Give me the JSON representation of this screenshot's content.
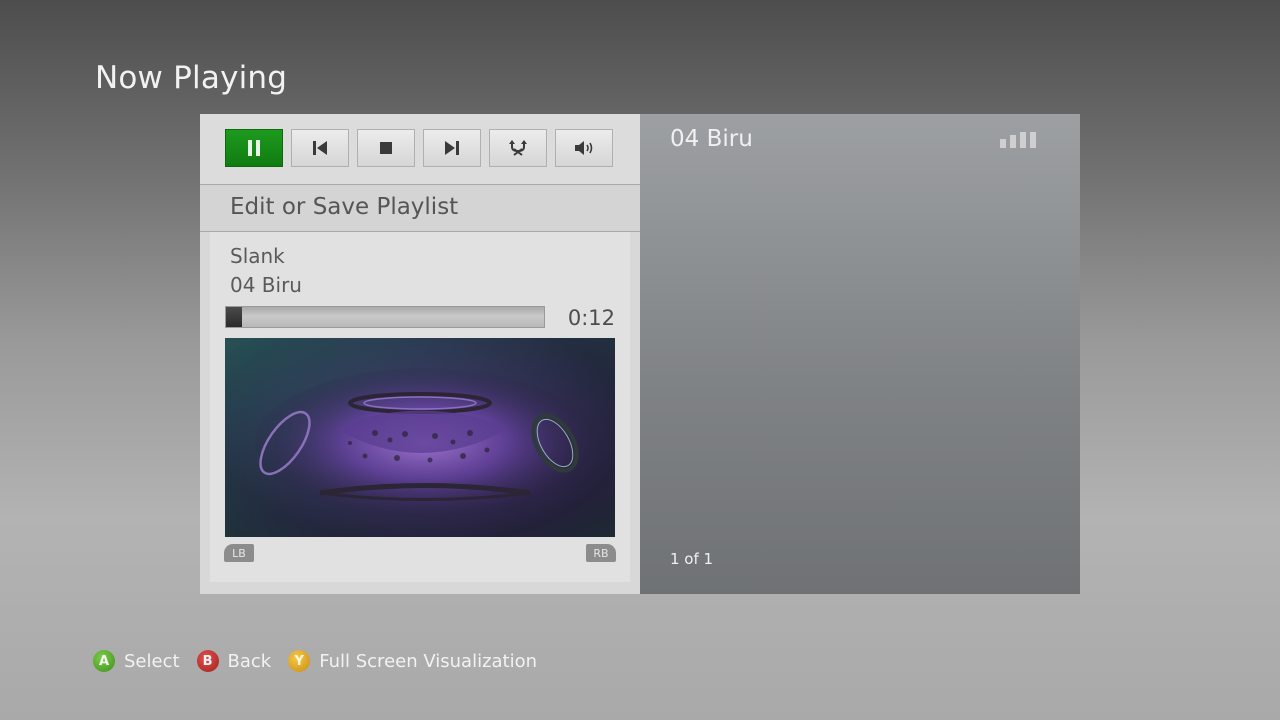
{
  "page_title": "Now Playing",
  "controls": [
    {
      "name": "pause",
      "icon": "pause-icon",
      "active": true
    },
    {
      "name": "previous",
      "icon": "previous-track-icon",
      "active": false
    },
    {
      "name": "stop",
      "icon": "stop-icon",
      "active": false
    },
    {
      "name": "next",
      "icon": "next-track-icon",
      "active": false
    },
    {
      "name": "shuffle-repeat",
      "icon": "shuffle-repeat-icon",
      "active": false
    },
    {
      "name": "volume",
      "icon": "volume-icon",
      "active": false
    }
  ],
  "playlist": {
    "label": "Edit or Save Playlist"
  },
  "now_playing": {
    "artist": "Slank",
    "track": "04 Biru",
    "elapsed": "0:12",
    "progress_fraction": 0.05
  },
  "bumpers": {
    "left": "LB",
    "right": "RB"
  },
  "queue": {
    "title": "04 Biru",
    "page": "1 of 1",
    "indicator_icon": "equalizer-bars-icon"
  },
  "footer": {
    "a": {
      "key": "A",
      "label": "Select"
    },
    "b": {
      "key": "B",
      "label": "Back"
    },
    "y": {
      "key": "Y",
      "label": "Full Screen Visualization"
    }
  },
  "colors": {
    "accent_green": "#107c10",
    "a_button": "#5aa82d",
    "b_button": "#c12c29",
    "y_button": "#e0a722"
  }
}
